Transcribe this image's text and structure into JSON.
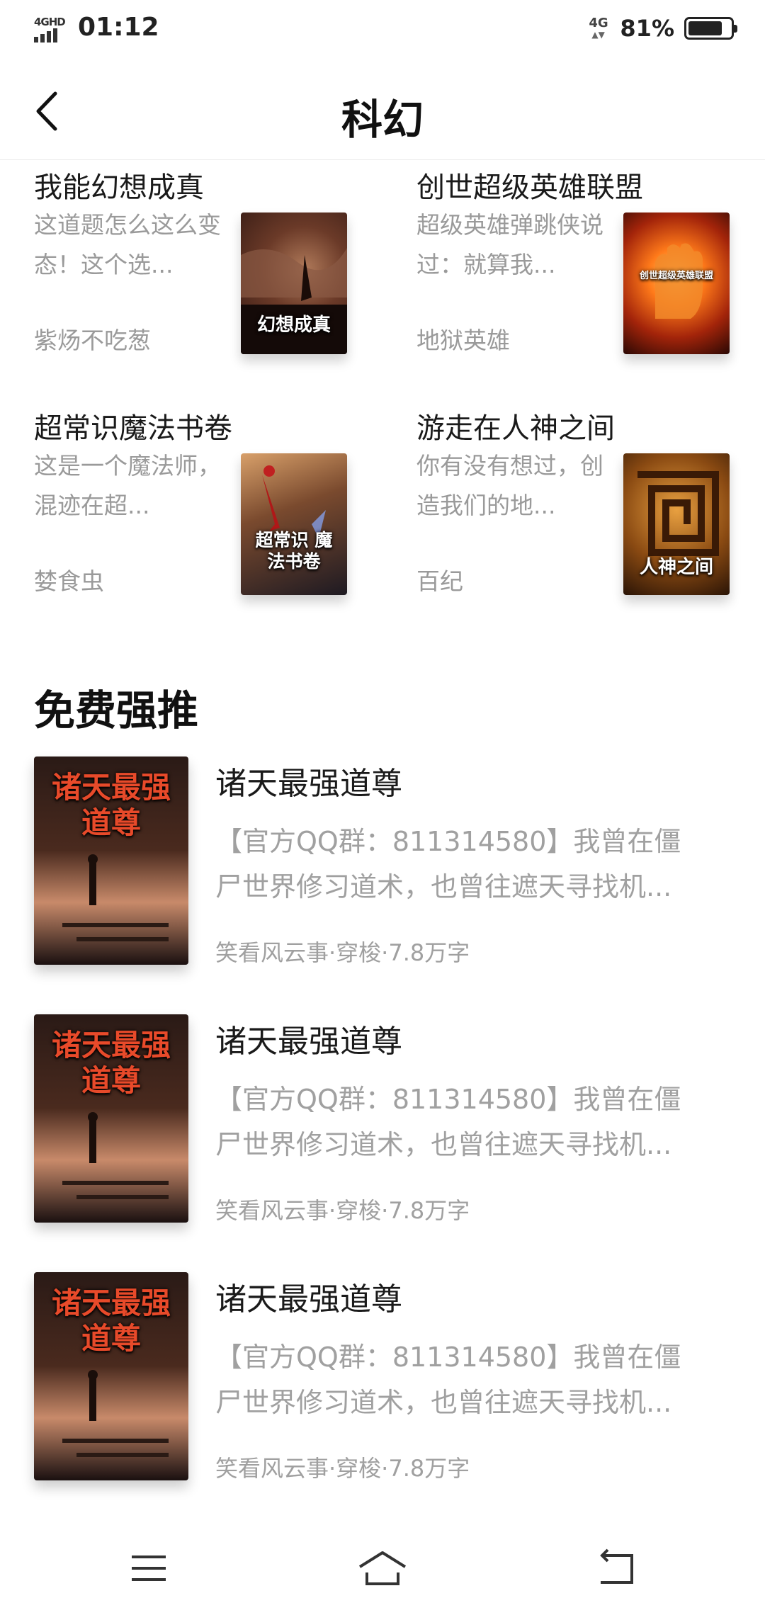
{
  "status": {
    "network": "4GHD",
    "time": "01:12",
    "net_right": "4G",
    "battery_pct": "81%",
    "battery_level": 0.81
  },
  "header": {
    "title": "科幻"
  },
  "grid": [
    {
      "title": "我能幻想成真",
      "desc": "这道题怎么这么变态！这个选...",
      "author": "紫炀不吃葱",
      "cover_text": "幻想成真"
    },
    {
      "title": "创世超级英雄联盟",
      "desc": "超级英雄弹跳侠说过：就算我...",
      "author": "地狱英雄",
      "cover_text": "创世超级英雄联盟"
    },
    {
      "title": "超常识魔法书卷",
      "desc": "这是一个魔法师，混迹在超...",
      "author": "婪食虫",
      "cover_text": "超常识 魔法书卷"
    },
    {
      "title": "游走在人神之间",
      "desc": "你有没有想过，创造我们的地...",
      "author": "百纪",
      "cover_text": "人神之间"
    }
  ],
  "section": {
    "title": "免费强推"
  },
  "list": [
    {
      "title": "诸天最强道尊",
      "desc_line1": "【官方QQ群：811314580】我曾在僵",
      "desc_line2": "尸世界修习道术，也曾往遮天寻找机...",
      "meta": "笑看风云事·穿梭·7.8万字",
      "cover_text_1": "诸天最强",
      "cover_text_2": "道尊"
    },
    {
      "title": "诸天最强道尊",
      "desc_line1": "【官方QQ群：811314580】我曾在僵",
      "desc_line2": "尸世界修习道术，也曾往遮天寻找机...",
      "meta": "笑看风云事·穿梭·7.8万字",
      "cover_text_1": "诸天最强",
      "cover_text_2": "道尊"
    },
    {
      "title": "诸天最强道尊",
      "desc_line1": "【官方QQ群：811314580】我曾在僵",
      "desc_line2": "尸世界修习道术，也曾往遮天寻找机...",
      "meta": "笑看风云事·穿梭·7.8万字",
      "cover_text_1": "诸天最强",
      "cover_text_2": "道尊"
    }
  ],
  "nav": {
    "menu_icon": "menu-icon",
    "home_icon": "home-icon",
    "back_icon": "return-icon"
  },
  "colors": {
    "text_primary": "#1a1a1a",
    "text_secondary": "#9a9a9a"
  }
}
